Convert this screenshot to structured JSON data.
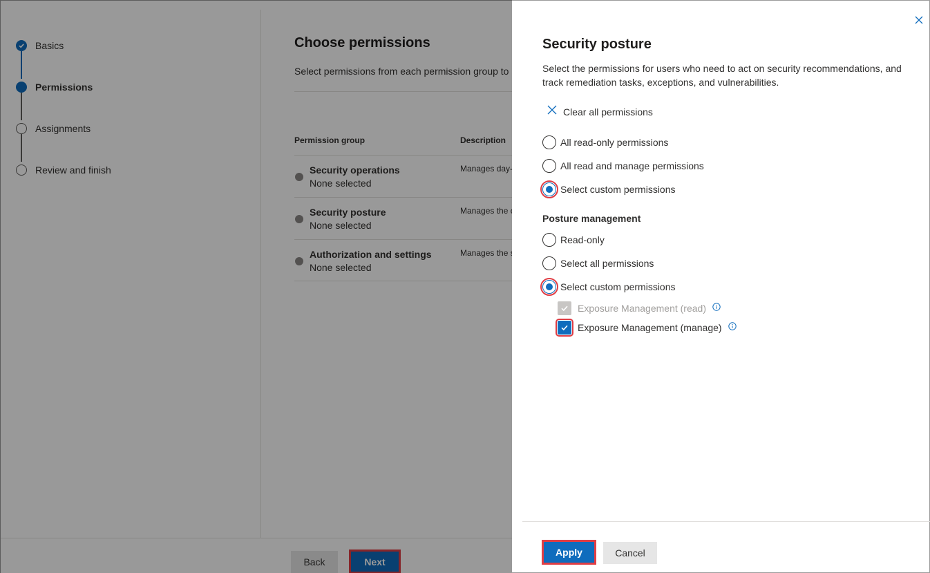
{
  "wizard": {
    "steps": [
      {
        "label": "Basics",
        "state": "done"
      },
      {
        "label": "Permissions",
        "state": "current"
      },
      {
        "label": "Assignments",
        "state": "todo"
      },
      {
        "label": "Review and finish",
        "state": "todo"
      }
    ],
    "title": "Choose permissions",
    "subtitle": "Select permissions from each permission group to c",
    "table": {
      "headers": [
        "Permission group",
        "Description"
      ],
      "rows": [
        {
          "name": "Security operations",
          "status": "None selected",
          "desc": "Manages day-"
        },
        {
          "name": "Security posture",
          "status": "None selected",
          "desc": "Manages the c"
        },
        {
          "name": "Authorization and settings",
          "status": "None selected",
          "desc": "Manages the s"
        }
      ]
    },
    "footer": {
      "back": "Back",
      "next": "Next"
    }
  },
  "panel": {
    "title": "Security posture",
    "description": "Select the permissions for users who need to act on security recommendations, and track remediation tasks, exceptions, and vulnerabilities.",
    "clear_label": "Clear all permissions",
    "options": [
      {
        "label": "All read-only permissions",
        "selected": false
      },
      {
        "label": "All read and manage permissions",
        "selected": false
      },
      {
        "label": "Select custom permissions",
        "selected": true
      }
    ],
    "section_title": "Posture management",
    "posture_options": [
      {
        "label": "Read-only",
        "selected": false
      },
      {
        "label": "Select all permissions",
        "selected": false
      },
      {
        "label": "Select custom permissions",
        "selected": true
      }
    ],
    "checkboxes": [
      {
        "label": "Exposure Management (read)",
        "checked": true,
        "disabled": true
      },
      {
        "label": "Exposure Management (manage)",
        "checked": true,
        "disabled": false
      }
    ],
    "apply": "Apply",
    "cancel": "Cancel"
  },
  "colors": {
    "accent": "#0f6cbd",
    "highlight": "#e03e45"
  }
}
